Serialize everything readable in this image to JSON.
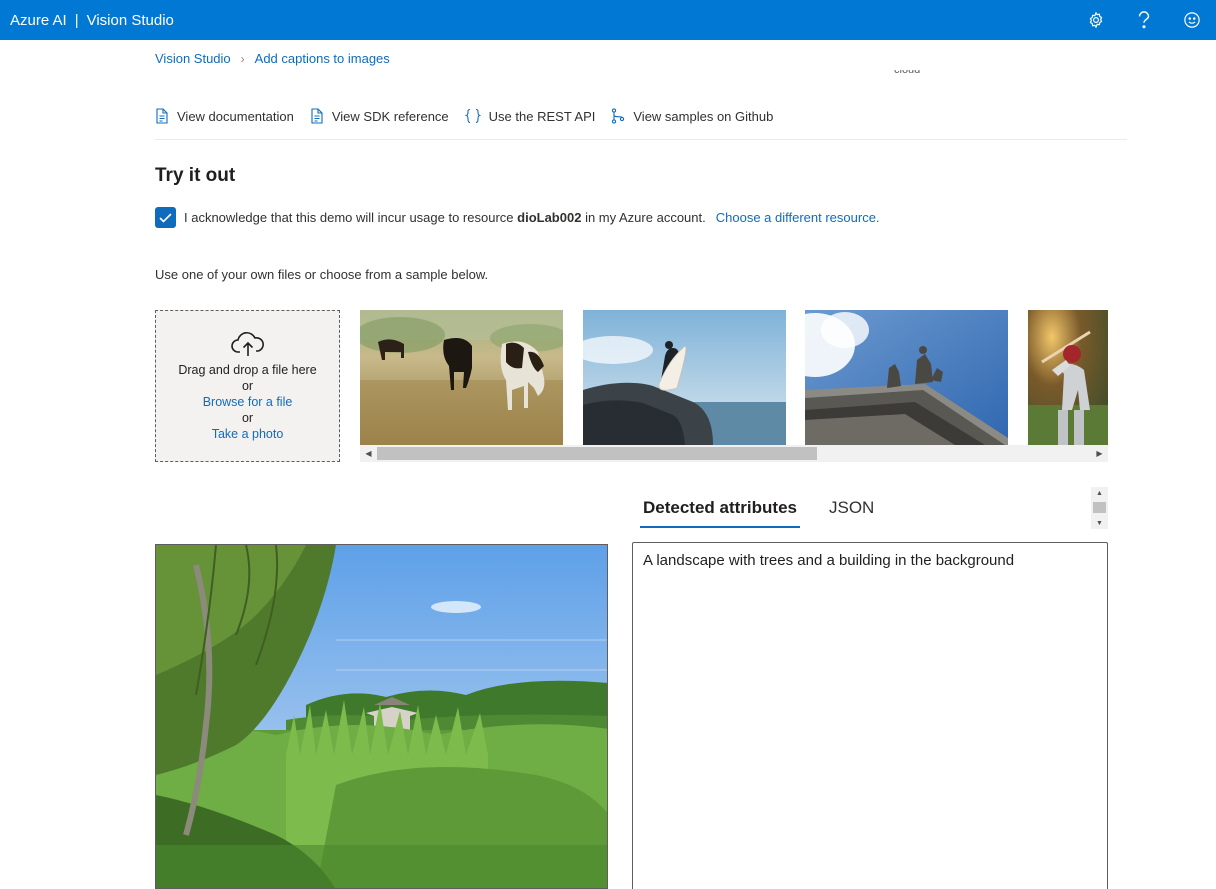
{
  "header": {
    "brand": "Azure AI",
    "separator": "|",
    "product": "Vision Studio",
    "icons": [
      "settings-icon",
      "help-icon",
      "feedback-smiley-icon"
    ]
  },
  "breadcrumb": {
    "root": "Vision Studio",
    "current": "Add captions to images"
  },
  "cutoff_text": "cloud",
  "resource_links": {
    "documentation": "View documentation",
    "sdk": "View SDK reference",
    "rest": "Use the REST API",
    "github": "View samples on Github"
  },
  "try_it": {
    "title": "Try it out",
    "acknowledge_checked": true,
    "ack_prefix": "I acknowledge that this demo will incur usage to resource",
    "resource_name": "dioLab002",
    "ack_suffix": "in my Azure account.",
    "choose_link": "Choose a different resource."
  },
  "upload": {
    "hint": "Use one of your own files or choose from a sample below.",
    "drag_text": "Drag and drop a file here",
    "or_1": "or",
    "browse_link": "Browse for a file",
    "or_2": "or",
    "photo_link": "Take a photo"
  },
  "samples": [
    "cows grazing in a field",
    "surfer holding a surfboard on a rock",
    "statues on a classical building roof",
    "baseball batter"
  ],
  "results": {
    "tabs": [
      "Detected attributes",
      "JSON"
    ],
    "active_tab": "Detected attributes",
    "caption": "A landscape with trees and a building in the background"
  },
  "colors": {
    "accent": "#0078d4",
    "link": "#0f6cbd"
  }
}
